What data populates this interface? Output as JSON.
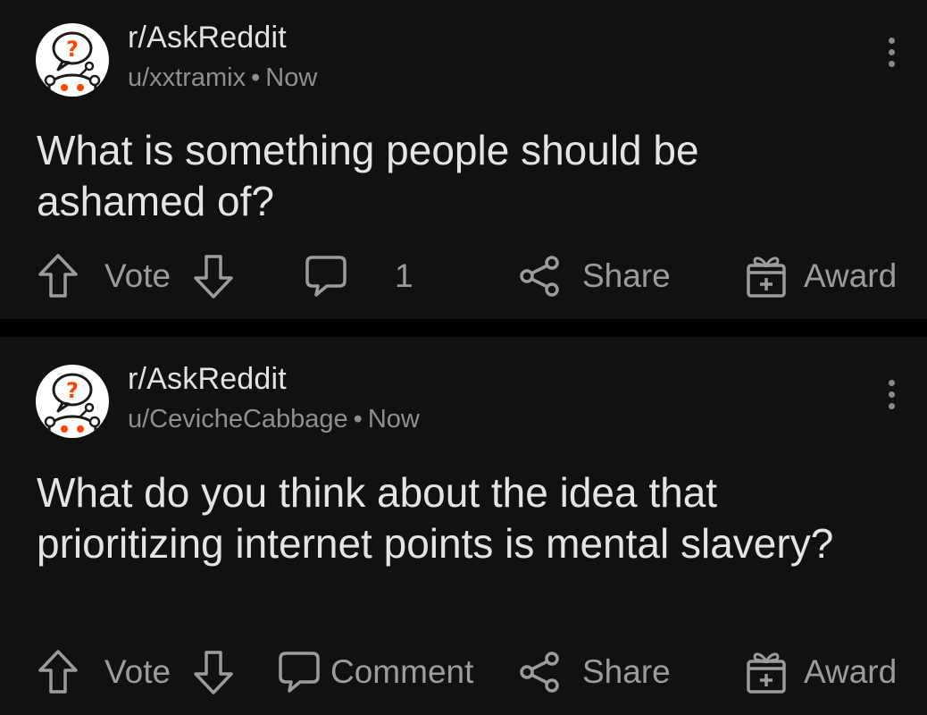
{
  "posts": [
    {
      "subreddit": "r/AskReddit",
      "username": "u/xxtramix",
      "separator": "•",
      "time": "Now",
      "title": "What is something people should be ashamed of?",
      "actions": {
        "vote_label": "Vote",
        "comment_count": "1",
        "share_label": "Share",
        "award_label": "Award"
      }
    },
    {
      "subreddit": "r/AskReddit",
      "username": "u/CevicheCabbage",
      "separator": "•",
      "time": "Now",
      "title": "What do you think about the idea that prioritizing internet points is mental slavery?",
      "actions": {
        "vote_label": "Vote",
        "comment_label": "Comment",
        "share_label": "Share",
        "award_label": "Award"
      }
    }
  ],
  "colors": {
    "background": "#111111",
    "divider": "#000000",
    "text_primary": "#e4e4e4",
    "text_secondary": "#8f8f8f",
    "action": "#9c9c9c",
    "icon_accent": "#ff4500"
  },
  "icons": {
    "avatar": "askreddit-snoo-icon",
    "more": "more-vertical-icon",
    "upvote": "arrow-up-icon",
    "downvote": "arrow-down-icon",
    "comment": "comment-bubble-icon",
    "share": "share-icon",
    "award": "gift-icon"
  }
}
